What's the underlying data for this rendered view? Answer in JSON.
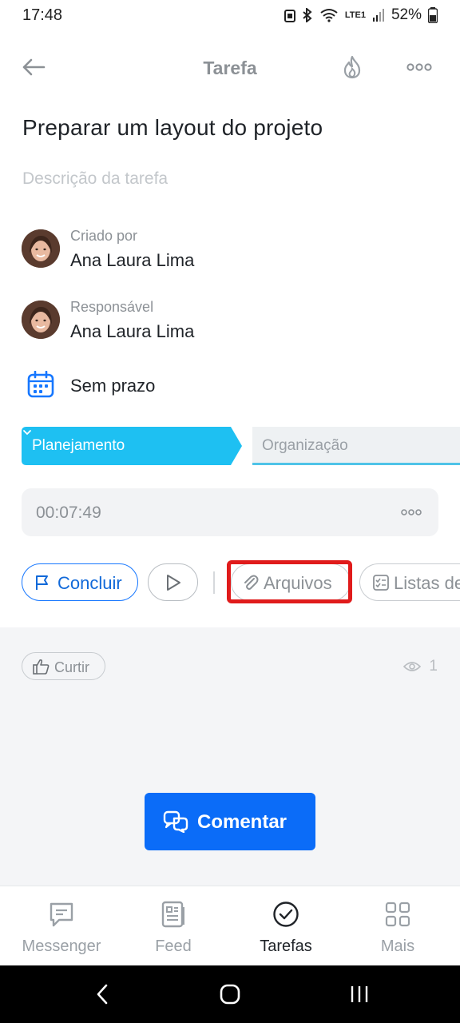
{
  "status_bar": {
    "time": "17:48",
    "battery": "52%",
    "network": "LTE1"
  },
  "header": {
    "title": "Tarefa"
  },
  "task": {
    "title": "Preparar um layout do projeto",
    "description_placeholder": "Descrição da tarefa"
  },
  "created_by": {
    "label": "Criado por",
    "name": "Ana Laura Lima"
  },
  "responsible": {
    "label": "Responsável",
    "name": "Ana Laura Lima"
  },
  "deadline": {
    "text": "Sem prazo"
  },
  "stages": {
    "current": "Planejamento",
    "next": "Organização"
  },
  "timer": {
    "value": "00:07:49"
  },
  "actions": {
    "complete_label": "Concluir",
    "files_label": "Arquivos",
    "checklist_label": "Listas de"
  },
  "feedback": {
    "like_label": "Curtir",
    "views_count": "1"
  },
  "comment_button": {
    "label": "Comentar"
  },
  "bottom_nav": {
    "items": [
      {
        "label": "Messenger",
        "icon": "chat-icon",
        "active": false
      },
      {
        "label": "Feed",
        "icon": "feed-icon",
        "active": false
      },
      {
        "label": "Tarefas",
        "icon": "check-circle-icon",
        "active": true
      },
      {
        "label": "Mais",
        "icon": "grid-icon",
        "active": false
      }
    ]
  },
  "colors": {
    "accent": "#0b6cf8",
    "stage_active": "#1ec0f2",
    "highlight": "#e01b1b",
    "muted_text": "#8c9196"
  }
}
